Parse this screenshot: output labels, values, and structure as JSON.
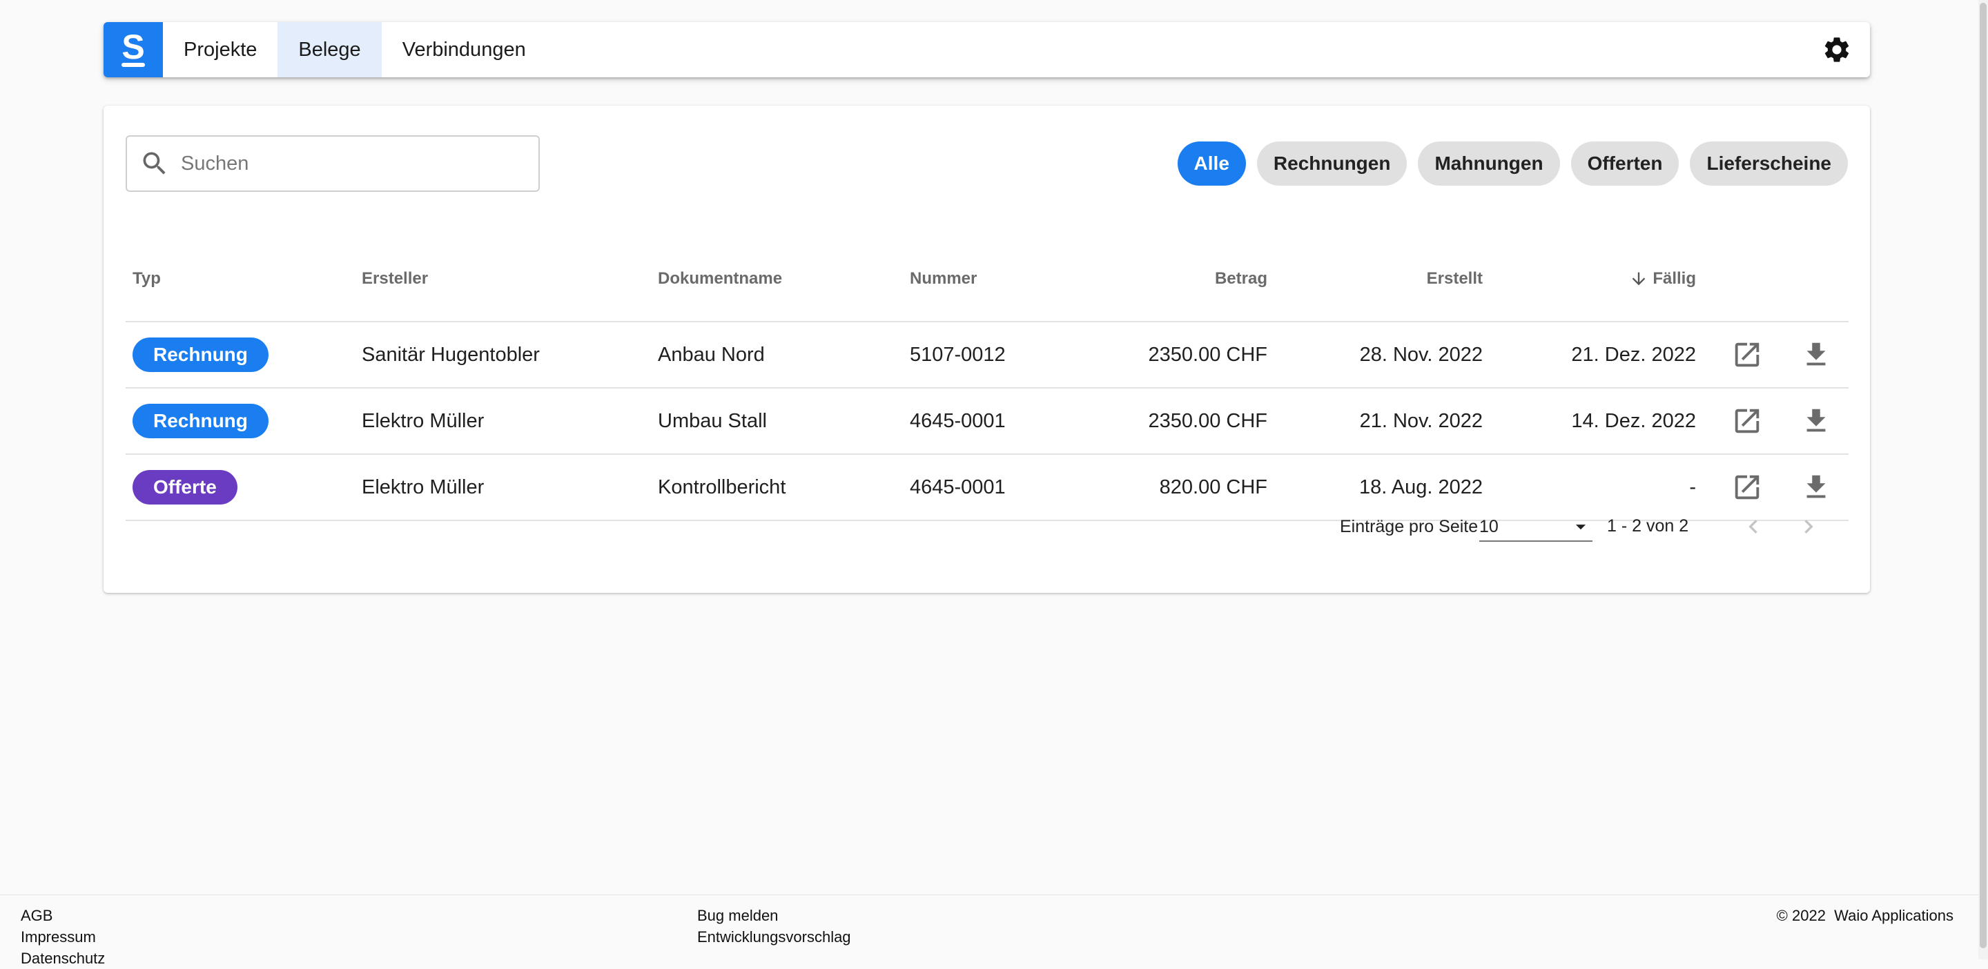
{
  "nav": {
    "logo_letter": "S",
    "items": [
      {
        "label": "Projekte"
      },
      {
        "label": "Belege",
        "active": true
      },
      {
        "label": "Verbindungen"
      }
    ],
    "settings_icon": "gear-icon"
  },
  "search": {
    "placeholder": "Suchen",
    "value": ""
  },
  "filters": [
    {
      "label": "Alle",
      "active": true
    },
    {
      "label": "Rechnungen"
    },
    {
      "label": "Mahnungen"
    },
    {
      "label": "Offerten"
    },
    {
      "label": "Lieferscheine"
    }
  ],
  "table": {
    "headers": {
      "typ": "Typ",
      "ersteller": "Ersteller",
      "dokumentname": "Dokumentname",
      "nummer": "Nummer",
      "betrag": "Betrag",
      "erstellt": "Erstellt",
      "faellig": "Fällig"
    },
    "sort_icon": "arrow-down-icon",
    "rows": [
      {
        "typ": "Rechnung",
        "ersteller": "Sanitär Hugentobler",
        "dokumentname": "Anbau Nord",
        "nummer": "5107-0012",
        "betrag": "2350.00 CHF",
        "erstellt": "28. Nov. 2022",
        "faellig": "21. Dez. 2022"
      },
      {
        "typ": "Rechnung",
        "ersteller": "Elektro Müller",
        "dokumentname": "Umbau Stall",
        "nummer": "4645-0001",
        "betrag": "2350.00 CHF",
        "erstellt": "21. Nov. 2022",
        "faellig": "14. Dez. 2022"
      },
      {
        "typ": "Offerte",
        "ersteller": "Elektro Müller",
        "dokumentname": "Kontrollbericht",
        "nummer": "4645-0001",
        "betrag": "820.00 CHF",
        "erstellt": "18. Aug. 2022",
        "faellig": "-"
      }
    ]
  },
  "badge_colors": {
    "Rechnung": "#1a7ef0",
    "Offerte": "#6a3cc1"
  },
  "pagination": {
    "per_page_label": "Einträge pro Seite",
    "per_page_value": "10",
    "range": "1 - 2 von 2"
  },
  "footer": {
    "left": [
      "AGB",
      "Impressum",
      "Datenschutz"
    ],
    "center": [
      "Bug melden",
      "Entwicklungsvorschlag"
    ],
    "right": "© 2022  Waio Applications"
  }
}
